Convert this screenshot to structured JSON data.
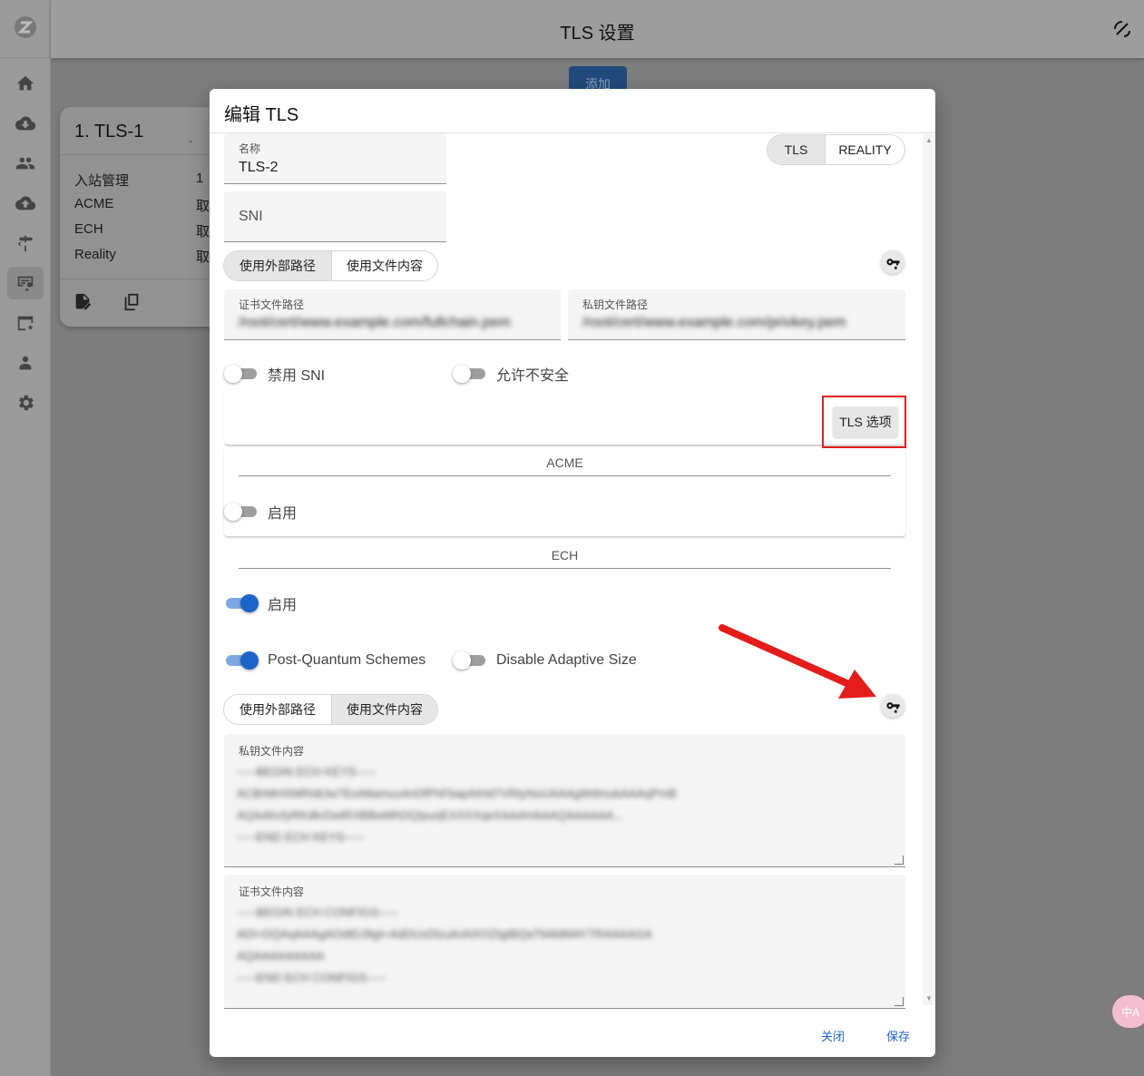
{
  "app": {
    "title": "TLS 设置",
    "add_button": "添加",
    "sidebar": [
      "home-icon",
      "inbound-icon",
      "users-icon",
      "outbound-icon",
      "rules-icon",
      "tls-icon",
      "dns-icon",
      "admin-icon",
      "settings-icon"
    ]
  },
  "tls_card": {
    "title": "1. TLS-1",
    "dash": "-",
    "rows": [
      {
        "label": "入站管理",
        "value": "1"
      },
      {
        "label": "ACME",
        "value": "取"
      },
      {
        "label": "ECH",
        "value": "取"
      },
      {
        "label": "Reality",
        "value": "取"
      }
    ]
  },
  "dialog": {
    "title": "编辑 TLS",
    "name_label": "名称",
    "name_value": "TLS-2",
    "sni_placeholder": "SNI",
    "mode_tabs": [
      "TLS",
      "REALITY"
    ],
    "cert_source_tabs": [
      "使用外部路径",
      "使用文件内容"
    ],
    "cert_path_label": "证书文件路径",
    "cert_path_value": "/root/cert/www.example.com/fullchain.pem",
    "key_path_label": "私钥文件路径",
    "key_path_value": "/root/cert/www.example.com/privkey.pem",
    "disable_sni": "禁用 SNI",
    "allow_insecure": "允许不安全",
    "tls_options_button": "TLS 选项",
    "acme_title": "ACME",
    "acme_enable": "启用",
    "ech_title": "ECH",
    "ech_enable": "启用",
    "post_quantum": "Post-Quantum Schemes",
    "disable_adaptive": "Disable Adaptive Size",
    "ech_source_tabs": [
      "使用外部路径",
      "使用文件内容"
    ],
    "ech_key_label": "私钥文件内容",
    "ech_key_lines": [
      "-----BEGIN ECH KEYS-----",
      "ACBrMHXMRIdtJw7EoA8amuu4nDfPhFbapAIHd7VRtyNoUAAAgWdmubAAAqPmB",
      "AQAAhcfyRKdkrDwiRXBBwMhDQIpurjEXXXXqeXAAAHAAAQAAAAAA...",
      "-----END ECH KEYS-----"
    ],
    "ech_cert_label": "证书文件内容",
    "ech_cert_lines": [
      "-----BEGIN ECH CONFIGS-----",
      "ADl+DQAqAAAgAOdtDJ9gt+AdDUxDlzuAsNXOZtgtBQaTkMdMAYTRAAAAGA",
      "AQAAAAAAAAA",
      "-----END ECH CONFIGS-----"
    ],
    "close_button": "关闭",
    "save_button": "保存"
  },
  "translate_badge": "中A"
}
